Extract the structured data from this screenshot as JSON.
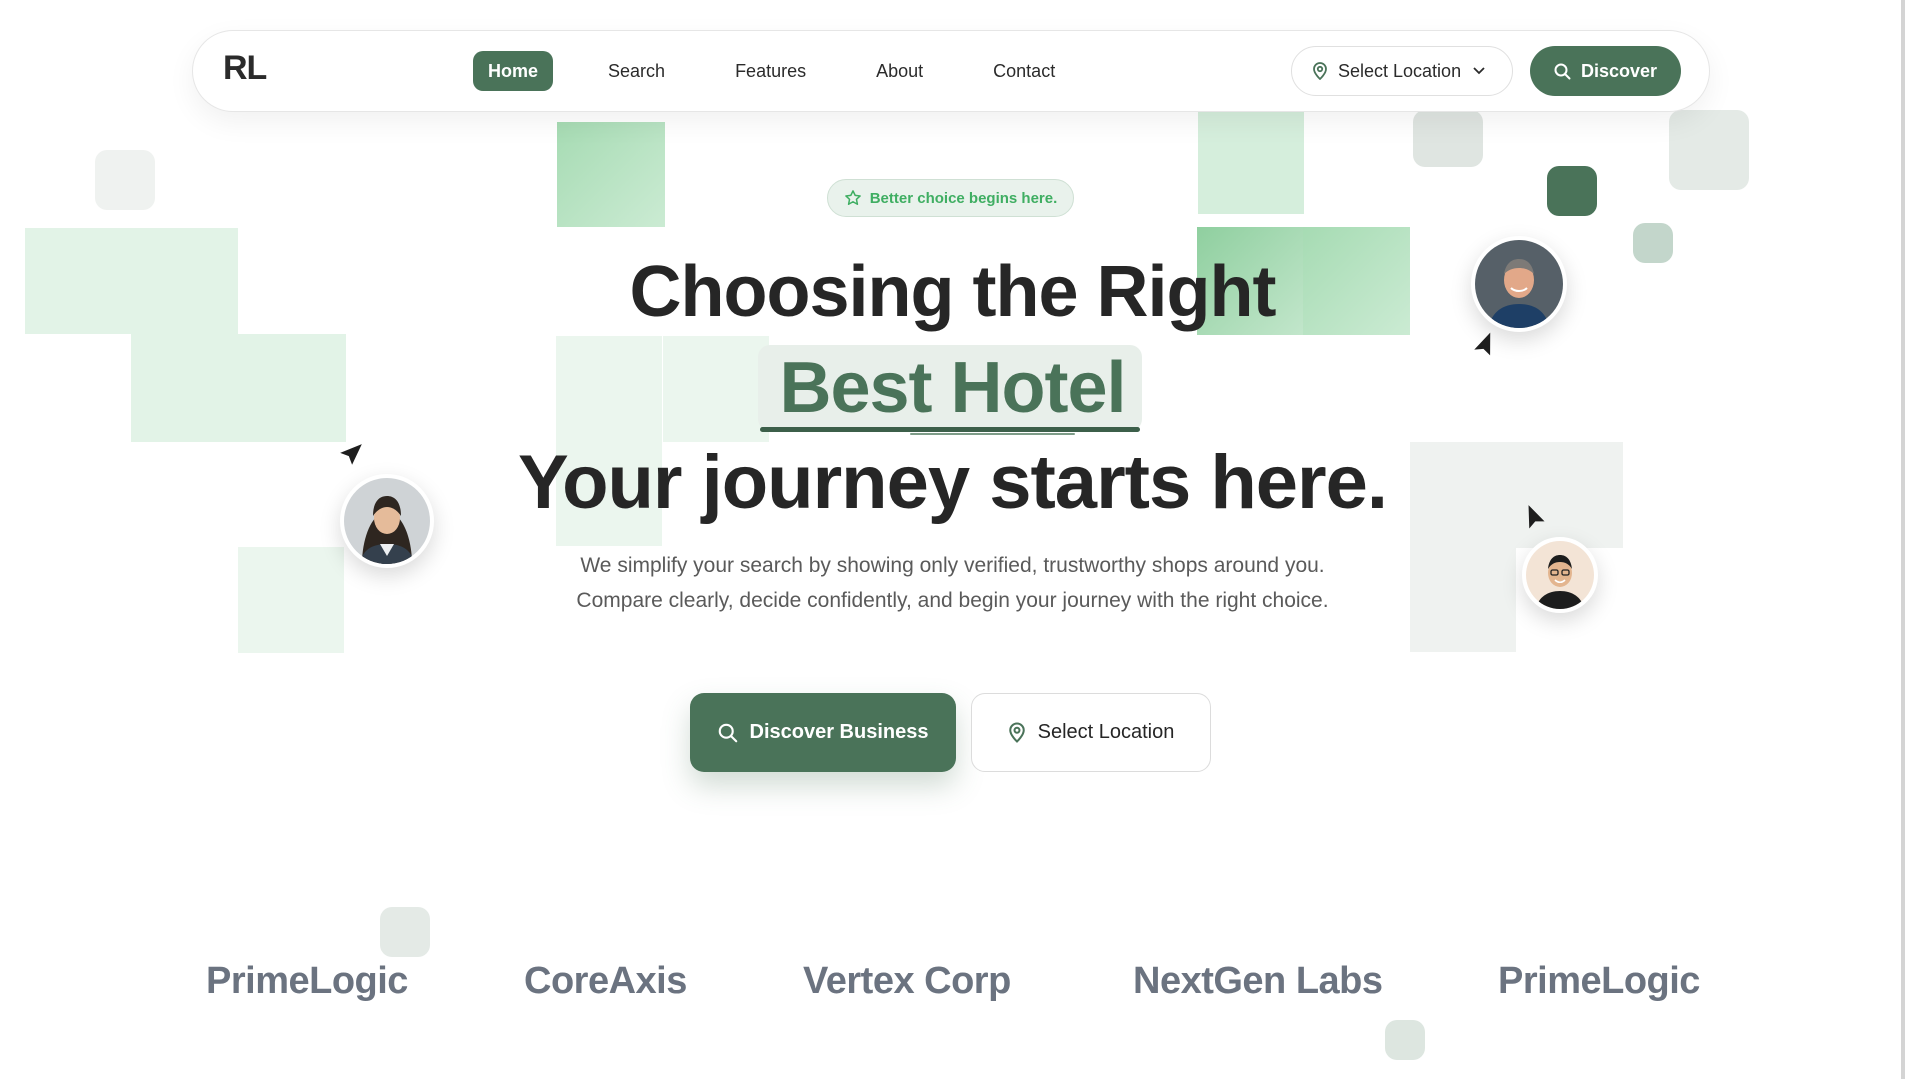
{
  "navbar": {
    "logo": "RL",
    "links": [
      {
        "label": "Home",
        "active": true
      },
      {
        "label": "Search",
        "active": false
      },
      {
        "label": "Features",
        "active": false
      },
      {
        "label": "About",
        "active": false
      },
      {
        "label": "Contact",
        "active": false
      }
    ],
    "location_select": "Select Location",
    "discover_button": "Discover"
  },
  "hero": {
    "badge": "Better choice begins here.",
    "headline_line1": "Choosing the Right",
    "headline_highlight": "Best Hotel",
    "headline_line3": "Your journey starts here.",
    "description": "We simplify your search by showing only verified, trustworthy shops around you. Compare clearly, decide confidently, and begin your journey with the right choice.",
    "primary_cta": "Discover Business",
    "secondary_cta": "Select Location"
  },
  "brands": [
    "PrimeLogic",
    "CoreAxis",
    "Vertex Corp",
    "NextGen Labs",
    "PrimeLogic"
  ],
  "colors": {
    "accent": "#4a7359",
    "badge_text": "#3fae62",
    "heading": "#262626",
    "brand_text": "#6b7380"
  },
  "icons": {
    "location": "map-pin-icon",
    "search": "search-icon",
    "chevron": "chevron-down-icon",
    "star": "star-icon",
    "cursor": "cursor-arrow-icon"
  }
}
